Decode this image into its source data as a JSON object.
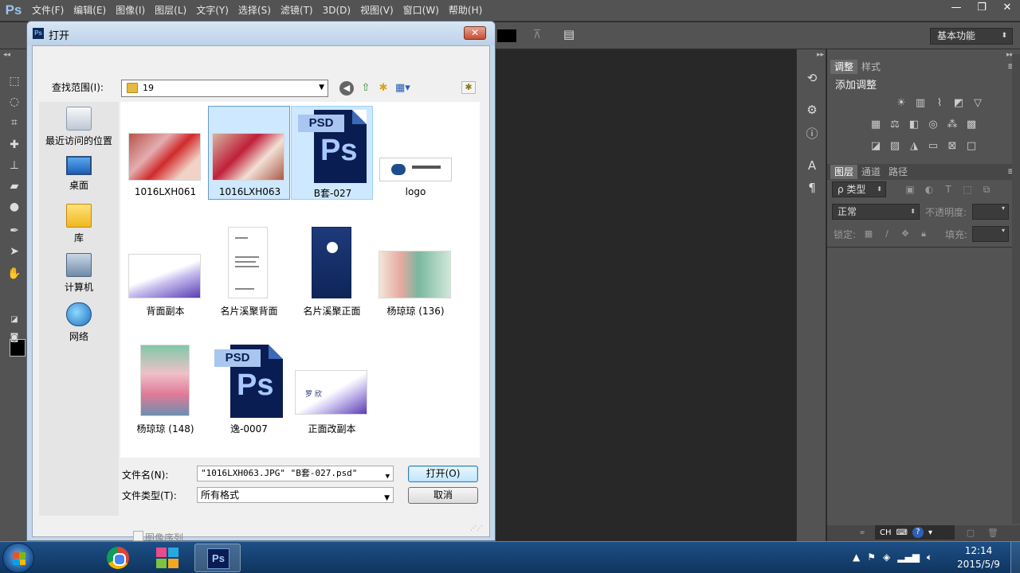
{
  "app": {
    "logo": "Ps",
    "menu": [
      "文件(F)",
      "编辑(E)",
      "图像(I)",
      "图层(L)",
      "文字(Y)",
      "选择(S)",
      "滤镜(T)",
      "3D(D)",
      "视图(V)",
      "窗口(W)",
      "帮助(H)"
    ],
    "workspace": "基本功能"
  },
  "panels": {
    "adjust_tabs": [
      "调整",
      "样式"
    ],
    "adjust_title": "添加调整",
    "layers_tabs": [
      "图层",
      "通道",
      "路径"
    ],
    "kind_filter": "ρ 类型",
    "blend_mode": "正常",
    "opacity_label": "不透明度:",
    "lock_label": "锁定:",
    "fill_label": "填充:",
    "ime_lang": "CH"
  },
  "dialog": {
    "title": "打开",
    "lookin_label": "查找范围(I):",
    "lookin_value": "19",
    "places": [
      "最近访问的位置",
      "桌面",
      "库",
      "计算机",
      "网络"
    ],
    "files": [
      {
        "name": "1016LXH061",
        "kind": "photo",
        "selected": false
      },
      {
        "name": "1016LXH063",
        "kind": "photo",
        "selected": true
      },
      {
        "name": "B套-027",
        "kind": "psd",
        "selected": true
      },
      {
        "name": "logo",
        "kind": "image",
        "selected": false
      },
      {
        "name": "背面副本",
        "kind": "image",
        "selected": false
      },
      {
        "name": "名片溪聚背面",
        "kind": "image",
        "selected": false
      },
      {
        "name": "名片溪聚正面",
        "kind": "image",
        "selected": false
      },
      {
        "name": "杨琼琼 (136)",
        "kind": "photo",
        "selected": false
      },
      {
        "name": "杨琼琼 (148)",
        "kind": "photo",
        "selected": false
      },
      {
        "name": "逸-0007",
        "kind": "psd",
        "selected": false
      },
      {
        "name": "正面改副本",
        "kind": "image",
        "selected": false
      }
    ],
    "psd_tag": "PSD",
    "psd_glyph": "Ps",
    "card_name": "罗 欣",
    "filename_label": "文件名(N):",
    "filename_value": "\"1016LXH063.JPG\" \"B套-027.psd\"",
    "filetype_label": "文件类型(T):",
    "filetype_value": "所有格式",
    "open_button": "打开(O)",
    "cancel_button": "取消",
    "sequence_label": "图像序列",
    "sequence_checked": false
  },
  "taskbar": {
    "ps_label": "Ps",
    "ime": "CH",
    "time": "12:14",
    "date": "2015/5/9"
  }
}
